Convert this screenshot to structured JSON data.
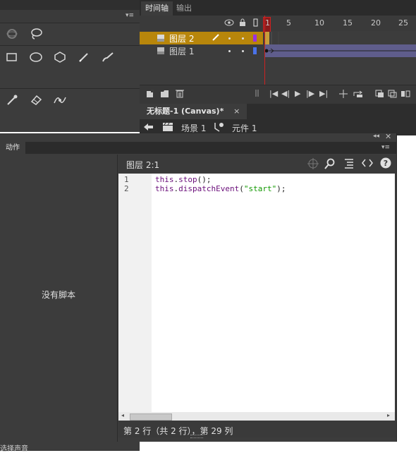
{
  "timeline": {
    "tabs": [
      "时间轴",
      "输出"
    ],
    "frame_numbers": [
      "1",
      "5",
      "10",
      "15",
      "20",
      "25"
    ],
    "layers": [
      {
        "name": "图层 2",
        "selected": true,
        "color": "#9b30e0"
      },
      {
        "name": "图层 1",
        "selected": false,
        "color": "#4a72e8"
      }
    ]
  },
  "document": {
    "tab_title": "无标题-1 (Canvas)*",
    "close_glyph": "×",
    "breadcrumb": {
      "scene": "场景 1",
      "symbol": "元件 1"
    }
  },
  "actions": {
    "tab_label": "动作",
    "no_script": "没有脚本",
    "location": "图层 2:1",
    "code_lines": [
      {
        "num": "1",
        "text": "this.stop();"
      },
      {
        "num": "2",
        "text": "this.dispatchEvent(\"start\");"
      }
    ],
    "status": "第 2 行（共 2 行），第 29 列"
  },
  "bottom_panel": {
    "label": "选择声音"
  },
  "colors": {
    "selected_layer": "#b8860b",
    "playhead": "#cc2222",
    "panel_bg": "#3c3c3c"
  }
}
